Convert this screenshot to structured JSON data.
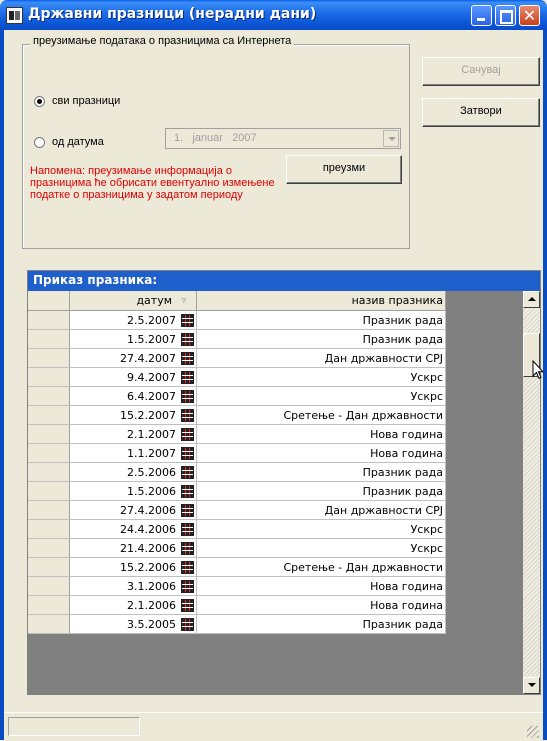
{
  "window": {
    "title": "Државни празници (нерадни дани)"
  },
  "download_group": {
    "legend": "преузимање података о празницима са Интернета",
    "radio_all_label": "сви празници",
    "radio_all_checked": true,
    "radio_from_date_label": "од датума",
    "radio_from_date_checked": false,
    "date_combo_value": "1.   januar   2007",
    "download_button": "преузми",
    "note": "Напомена: преузимање информација о празницима ће обрисати евентуално измењене податке о празницима у задатом периоду"
  },
  "buttons": {
    "save": "Сачувај",
    "save_enabled": false,
    "close": "Затвори"
  },
  "grid": {
    "caption": "Приказ празника:",
    "columns": [
      "датум",
      "назив празника"
    ],
    "sort_icon": "sort-arrow-icon",
    "rows": [
      {
        "date": "2.5.2007",
        "name": "Празник рада"
      },
      {
        "date": "1.5.2007",
        "name": "Празник рада"
      },
      {
        "date": "27.4.2007",
        "name": "Дан државности СРЈ"
      },
      {
        "date": "9.4.2007",
        "name": "Ускрс"
      },
      {
        "date": "6.4.2007",
        "name": "Ускрс"
      },
      {
        "date": "15.2.2007",
        "name": "Сретење - Дан државности"
      },
      {
        "date": "2.1.2007",
        "name": "Нова година"
      },
      {
        "date": "1.1.2007",
        "name": "Нова година"
      },
      {
        "date": "2.5.2006",
        "name": "Празник рада"
      },
      {
        "date": "1.5.2006",
        "name": "Празник рада"
      },
      {
        "date": "27.4.2006",
        "name": "Дан државности СРЈ"
      },
      {
        "date": "24.4.2006",
        "name": "Ускрс"
      },
      {
        "date": "21.4.2006",
        "name": "Ускрс"
      },
      {
        "date": "15.2.2006",
        "name": "Сретење - Дан државности"
      },
      {
        "date": "3.1.2006",
        "name": "Нова година"
      },
      {
        "date": "2.1.2006",
        "name": "Нова година"
      },
      {
        "date": "3.5.2005",
        "name": "Празник рада"
      }
    ]
  },
  "icons": {
    "app": "app-window-icon",
    "calendar": "calendar-icon",
    "minimize": "minimize-icon",
    "maximize": "maximize-icon",
    "close": "close-icon"
  },
  "colors": {
    "title_bar": "#0b54d4",
    "note_text": "#e00000",
    "grid_caption": "#1f5fcc"
  }
}
